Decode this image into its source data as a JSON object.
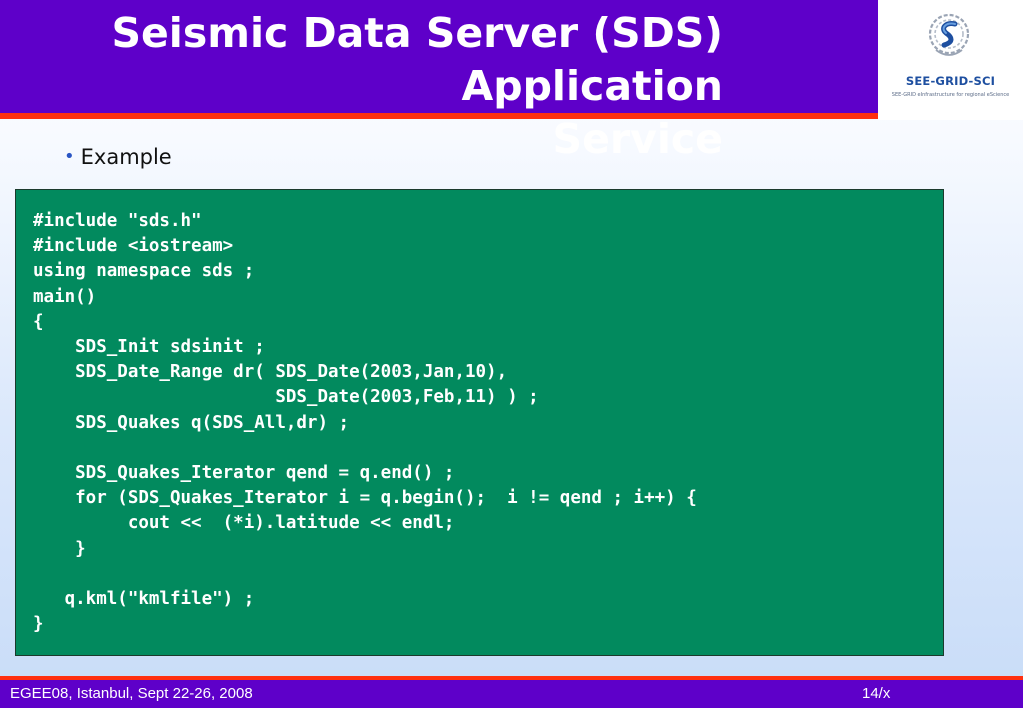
{
  "slide": {
    "title_line1": "Seismic Data Server (SDS) Application",
    "title_line2": "Service",
    "bullet": "Example",
    "code": "#include \"sds.h\"\n#include <iostream>\nusing namespace sds ;\nmain()\n{\n    SDS_Init sdsinit ;\n    SDS_Date_Range dr( SDS_Date(2003,Jan,10),\n                       SDS_Date(2003,Feb,11) ) ;\n    SDS_Quakes q(SDS_All,dr) ;\n\n    SDS_Quakes_Iterator qend = q.end() ;\n    for (SDS_Quakes_Iterator i = q.begin();  i != qend ; i++) {\n         cout <<  (*i).latitude << endl;\n    }\n\n   q.kml(\"kmlfile\") ;\n}"
  },
  "logo": {
    "name": "SEE-GRID-SCI",
    "tagline": "SEE-GRID eInfrastructure for regional eScience"
  },
  "footer": {
    "left": "EGEE08, Istanbul, Sept 22-26, 2008",
    "right": "14/x"
  },
  "colors": {
    "header": "#5e00c9",
    "accent": "#ff3010",
    "code_bg": "#028a5e"
  },
  "icons": {
    "logo_emblem": "see-grid-sci-logo-icon"
  }
}
